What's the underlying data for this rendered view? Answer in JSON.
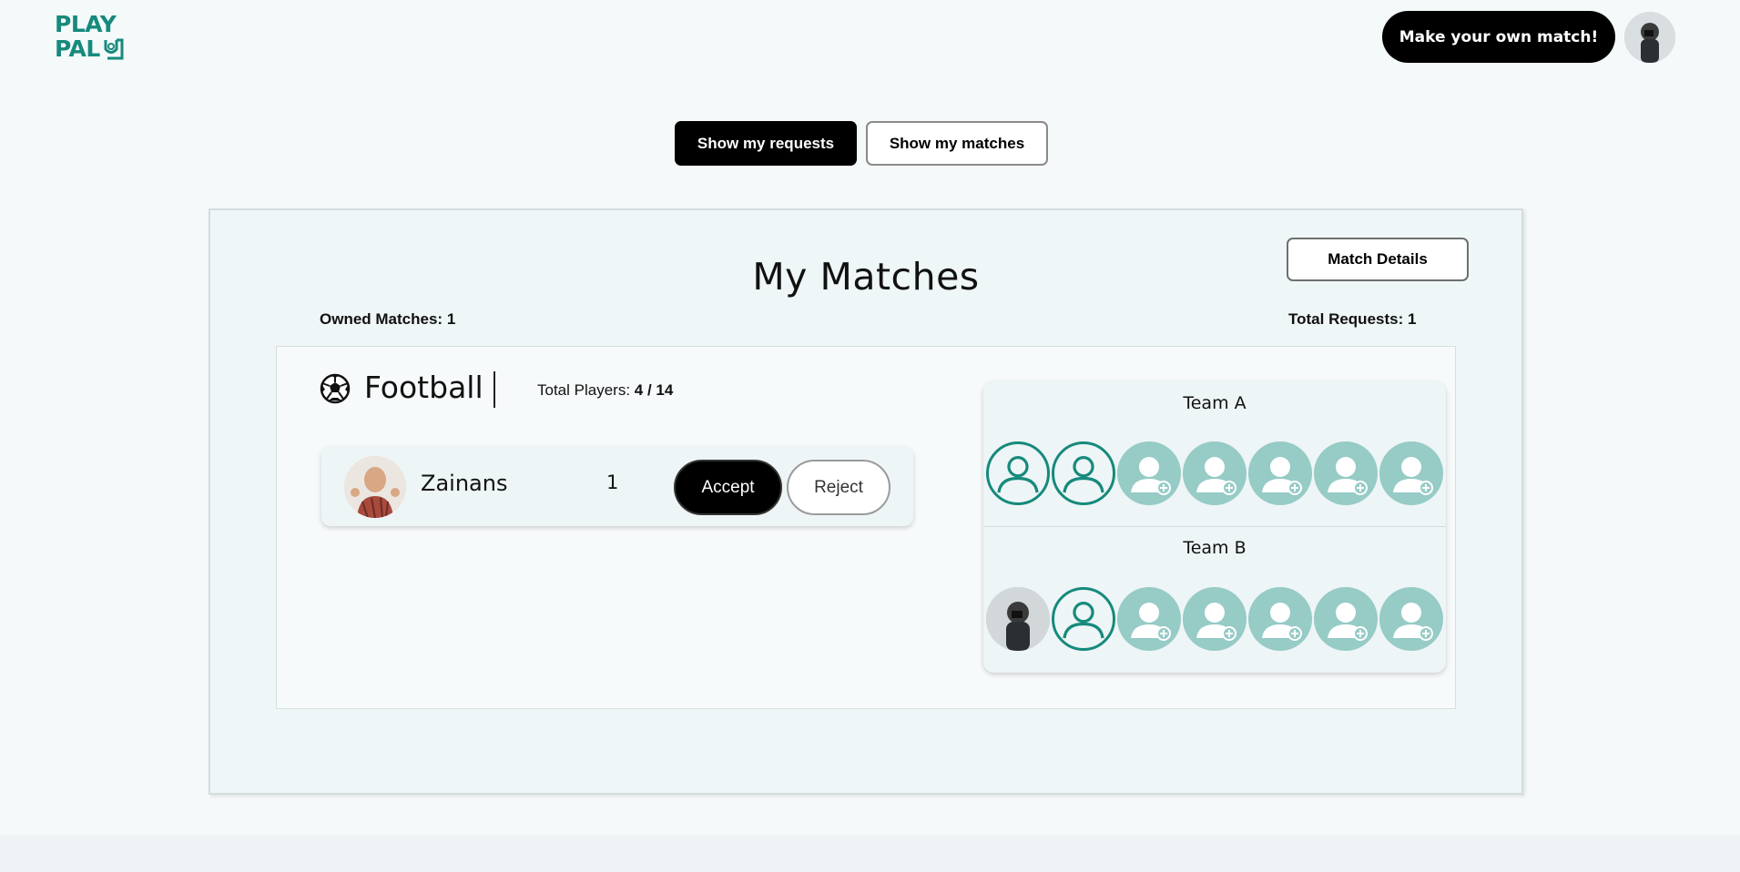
{
  "brand": {
    "line1": "PLAY",
    "line2": "PAL"
  },
  "header": {
    "cta_label": "Make your own match!"
  },
  "toggle": {
    "requests_label": "Show my requests",
    "matches_label": "Show my matches"
  },
  "card": {
    "title": "My Matches",
    "details_label": "Match Details",
    "owned_label": "Owned Matches: ",
    "owned_value": "1",
    "requests_label": "Total Requests: ",
    "requests_value": "1"
  },
  "match": {
    "sport": "Football",
    "sport_icon": "soccer-ball-icon",
    "players_label": "Total Players: ",
    "players_value": "4 / 14",
    "request": {
      "name": "Zainans",
      "count": "1",
      "accept_label": "Accept",
      "reject_label": "Reject"
    },
    "team_a": {
      "name": "Team A",
      "slots": [
        "filled",
        "filled",
        "empty",
        "empty",
        "empty",
        "empty",
        "empty"
      ]
    },
    "team_b": {
      "name": "Team B",
      "slots": [
        "photo",
        "filled",
        "empty",
        "empty",
        "empty",
        "empty",
        "empty"
      ]
    }
  },
  "colors": {
    "brand": "#168a7c",
    "empty_slot": "#96cbc6",
    "primary": "#000000"
  }
}
